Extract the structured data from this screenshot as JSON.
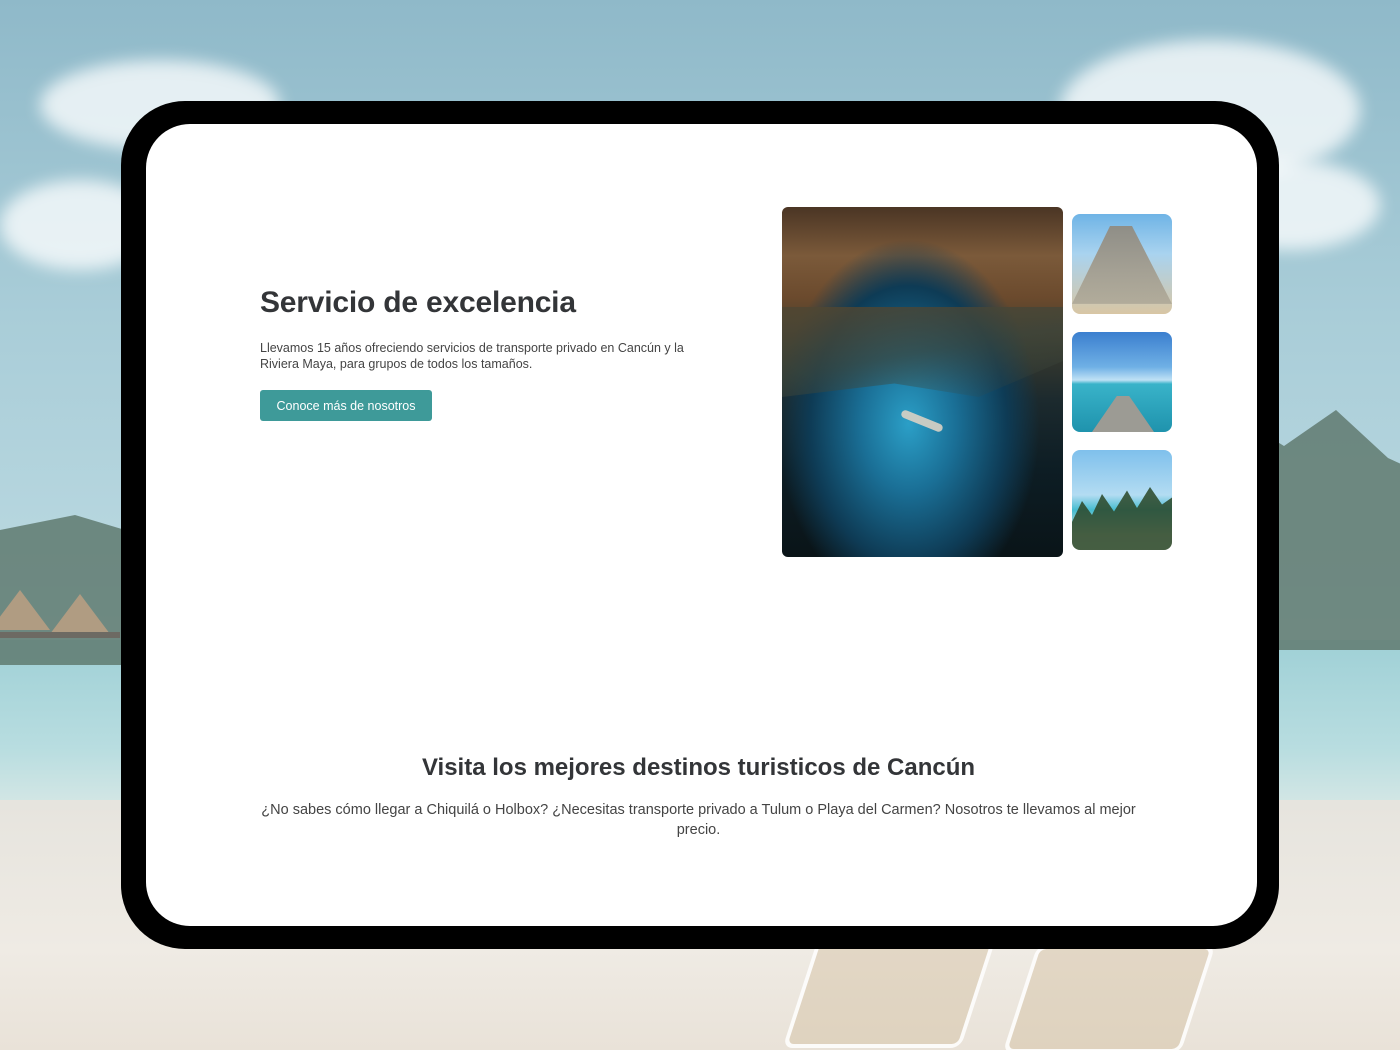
{
  "hero": {
    "title": "Servicio de excelencia",
    "description": "Llevamos 15 años ofreciendo servicios de transporte privado en Cancún y la Riviera Maya, para grupos de todos los tamaños.",
    "button_label": "Conoce más de nosotros"
  },
  "destinations": {
    "title": "Visita los mejores destinos turisticos de Cancún",
    "description": "¿No sabes cómo llegar a Chiquilá o Holbox? ¿Necesitas transporte privado a Tulum o Playa del Carmen? Nosotros te llevamos al mejor precio."
  },
  "colors": {
    "accent": "#3e9a99",
    "heading": "#333538",
    "device_frame": "#000000"
  }
}
